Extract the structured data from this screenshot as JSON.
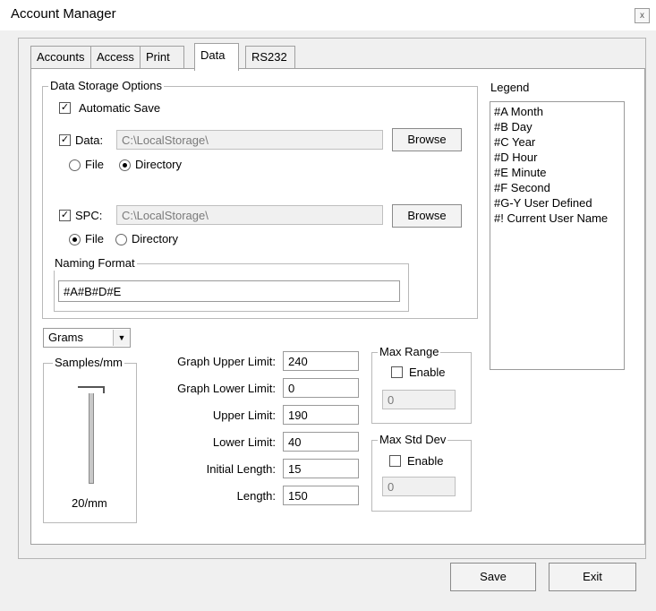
{
  "window": {
    "title": "Account Manager",
    "close_glyph": "x"
  },
  "tabs": [
    {
      "label": "Accounts",
      "active": false
    },
    {
      "label": "Access",
      "active": false
    },
    {
      "label": "Print",
      "active": false
    },
    {
      "label": "Data",
      "active": true
    },
    {
      "label": "RS232",
      "active": false
    }
  ],
  "storage": {
    "group_title": "Data Storage Options",
    "automatic_save": {
      "label": "Automatic Save",
      "checked": true
    },
    "data": {
      "label": "Data:",
      "checked": true,
      "path": "C:\\LocalStorage\\",
      "browse": "Browse",
      "radio_file": "File",
      "radio_directory": "Directory",
      "selected": "Directory"
    },
    "spc": {
      "label": "SPC:",
      "checked": true,
      "path": "C:\\LocalStorage\\",
      "browse": "Browse",
      "radio_file": "File",
      "radio_directory": "Directory",
      "selected": "File"
    },
    "naming": {
      "title": "Naming Format",
      "value": "#A#B#D#E"
    }
  },
  "legend": {
    "title": "Legend",
    "items": [
      "#A Month",
      "#B Day",
      "#C Year",
      "#D Hour",
      "#E Minute",
      "#F Second",
      "#G-Y User Defined",
      "#! Current User Name"
    ]
  },
  "units": {
    "selected": "Grams"
  },
  "samples": {
    "title": "Samples/mm",
    "value_label": "20/mm"
  },
  "limits": [
    {
      "label": "Graph Upper Limit:",
      "value": "240"
    },
    {
      "label": "Graph Lower Limit:",
      "value": "0"
    },
    {
      "label": "Upper Limit:",
      "value": "190"
    },
    {
      "label": "Lower Limit:",
      "value": "40"
    },
    {
      "label": "Initial Length:",
      "value": "15"
    },
    {
      "label": "Length:",
      "value": "150"
    }
  ],
  "max_range": {
    "title": "Max Range",
    "enable_label": "Enable",
    "checked": false,
    "value": "0"
  },
  "max_std_dev": {
    "title": "Max Std Dev",
    "enable_label": "Enable",
    "checked": false,
    "value": "0"
  },
  "footer": {
    "save": "Save",
    "exit": "Exit"
  }
}
